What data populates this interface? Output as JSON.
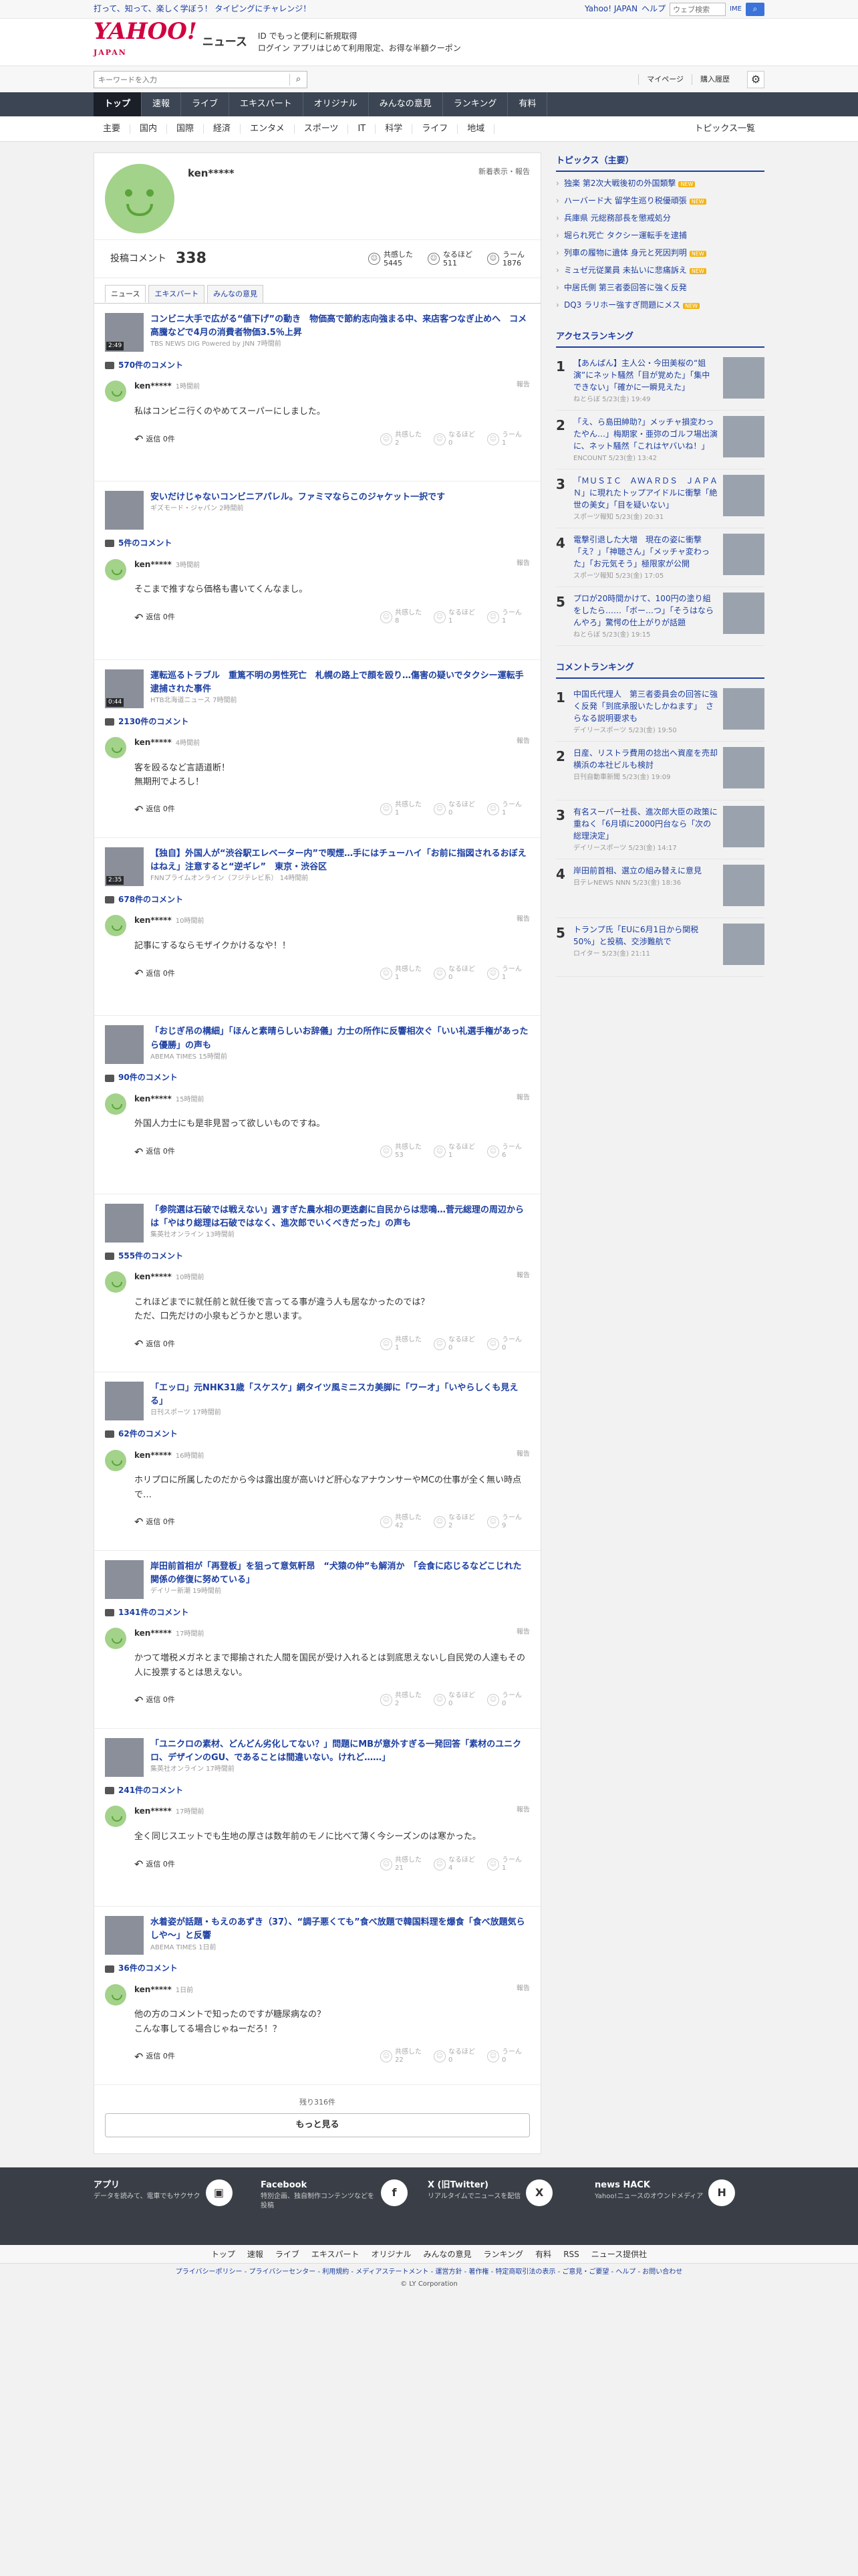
{
  "topbar": {
    "left_text": "打って、知って、楽しく学ぼう！ タイピングにチャレンジ！",
    "links": [
      "Yahoo! JAPAN",
      "ヘルプ"
    ],
    "search_placeholder": "ウェブ検索",
    "ime": "IME"
  },
  "header": {
    "logo": "YAHOO!",
    "logo_sub": "JAPAN",
    "service": "ニュース",
    "promo_line1": "ID でもっと便利に新規取得",
    "promo_line2": "ログイン  アプリはじめて利用限定、お得な半額クーポン"
  },
  "searchrow": {
    "placeholder": "キーワードを入力",
    "mypage": "マイページ",
    "history": "購入履歴"
  },
  "gnav": [
    "トップ",
    "速報",
    "ライブ",
    "エキスパート",
    "オリジナル",
    "みんなの意見",
    "ランキング",
    "有料"
  ],
  "subnav": [
    "主要",
    "国内",
    "国際",
    "経済",
    "エンタメ",
    "スポーツ",
    "IT",
    "科学",
    "ライフ",
    "地域"
  ],
  "subnav_all": "トピックス一覧",
  "profile": {
    "name": "ken*****",
    "badge": "新着表示・報告",
    "label": "投稿コメント",
    "count": "338",
    "reactions": [
      {
        "label": "共感した",
        "value": "5445"
      },
      {
        "label": "なるほど",
        "value": "511"
      },
      {
        "label": "うーん",
        "value": "1876"
      }
    ]
  },
  "tabs": [
    "ニュース",
    "エキスパート",
    "みんなの意見"
  ],
  "vote_labels": [
    "共感した",
    "なるほど",
    "うーん"
  ],
  "reply_label": "返信 0件",
  "report_label": "報告",
  "entries": [
    {
      "title": "コンビニ大手で広がる“値下げ”の動き　物価高で節約志向強まる中、来店客つなぎ止めへ　コメ高騰などで4月の消費者物価3.5％上昇",
      "source": "TBS NEWS DIG Powered by JNN 7時間前",
      "video": "2:49",
      "comments": "570件のコメント",
      "user": "ken*****",
      "time": "1時間前",
      "text": "私はコンビニ行くのやめてスーパーにしました。",
      "votes": [
        "2",
        "0",
        "1"
      ]
    },
    {
      "title": "安いだけじゃないコンビニアパレル。ファミマならこのジャケット一択です",
      "source": "ギズモード・ジャパン 2時間前",
      "video": "",
      "comments": "5件のコメント",
      "user": "ken*****",
      "time": "3時間前",
      "text": "そこまで推すなら価格も書いてくんなまし。",
      "votes": [
        "8",
        "1",
        "1"
      ]
    },
    {
      "title": "運転巡るトラブル　重篤不明の男性死亡　札幌の路上で顔を殴り…傷害の疑いでタクシー運転手逮捕された事件",
      "source": "HTB北海道ニュース 7時間前",
      "video": "0:44",
      "comments": "2130件のコメント",
      "user": "ken*****",
      "time": "4時間前",
      "text": "客を殴るなど言語道断！\n無期刑でよろし！",
      "votes": [
        "1",
        "0",
        "1"
      ]
    },
    {
      "title": "【独自】外国人が“渋谷駅エレベーター内”で喫煙…手にはチューハイ「お前に指図されるおぼえはねえ」注意すると“逆ギレ”　東京・渋谷区",
      "source": "FNNプライムオンライン（フジテレビ系） 14時間前",
      "video": "2:35",
      "comments": "678件のコメント",
      "user": "ken*****",
      "time": "10時間前",
      "text": "記事にするならモザイクかけるなや！！",
      "votes": [
        "1",
        "0",
        "1"
      ]
    },
    {
      "title": "「おじぎ吊の構細」「ほんと素晴らしいお辞儀」力士の所作に反響相次ぐ「いい礼選手権があったら優勝」の声も",
      "source": "ABEMA TIMES 15時間前",
      "video": "",
      "comments": "90件のコメント",
      "user": "ken*****",
      "time": "15時間前",
      "text": "外国人力士にも是非見習って欲しいものですね。",
      "votes": [
        "53",
        "1",
        "6"
      ]
    },
    {
      "title": "「参院選は石破では戦えない」週すぎた農水相の更迭劇に自民からは悲鳴…菅元総理の周辺からは「やはり総理は石破ではなく、進次郎でいくべきだった」の声も",
      "source": "集英社オンライン 13時間前",
      "video": "",
      "comments": "555件のコメント",
      "user": "ken*****",
      "time": "10時間前",
      "text": "これほどまでに就任前と就任後で言ってる事が違う人も居なかったのでは？\nただ、口先だけの小泉もどうかと思います。",
      "votes": [
        "1",
        "0",
        "0"
      ]
    },
    {
      "title": "「エッロ」元NHK31歳「スケスケ」網タイツ風ミニスカ美脚に「ワーオ」「いやらしくも見える」",
      "source": "日刊スポーツ 17時間前",
      "video": "",
      "comments": "62件のコメント",
      "user": "ken*****",
      "time": "16時間前",
      "text": "ホリプロに所属したのだから今は露出度が高いけど肝心なアナウンサーやMCの仕事が全く無い時点で…",
      "votes": [
        "42",
        "2",
        "9"
      ]
    },
    {
      "title": "岸田前首相が「再登板」を狙って意気軒昂　“犬猿の仲”も解消か　「会食に応じるなどこじれた関係の修復に努めている」",
      "source": "デイリー新潮 19時間前",
      "video": "",
      "comments": "1341件のコメント",
      "user": "ken*****",
      "time": "17時間前",
      "text": "かつて増税メガネとまで揶揄された人間を国民が受け入れるとは到底思えないし自民党の人達もその人に投票するとは思えない。",
      "votes": [
        "2",
        "0",
        "0"
      ]
    },
    {
      "title": "「ユニクロの素材、どんどん劣化してない？」問題にMBが意外すぎる一発回答「素材のユニクロ、デザインのGU、であることは間違いない。けれど……」",
      "source": "集英社オンライン 17時間前",
      "video": "",
      "comments": "241件のコメント",
      "user": "ken*****",
      "time": "17時間前",
      "text": "全く同じスエットでも生地の厚さは数年前のモノに比べて薄く今シーズンのは寒かった。",
      "votes": [
        "21",
        "4",
        "1"
      ]
    },
    {
      "title": "水着姿が話題・もえのあずき（37）、“調子悪くても”食べ放題で韓国料理を爆食「食べ放題気らしや～」と反響",
      "source": "ABEMA TIMES 1日前",
      "video": "",
      "comments": "36件のコメント",
      "user": "ken*****",
      "time": "1日前",
      "text": "他の方のコメントで知ったのですが糖尿病なの？\nこんな事してる場合じゃねーだろ！？",
      "votes": [
        "22",
        "0",
        "0"
      ]
    }
  ],
  "more": {
    "remaining": "残り316件",
    "button": "もっと見る"
  },
  "sidebar": {
    "topics_title": "トピックス（主要）",
    "topics": [
      "独楽 第2次大戦後初の外国類撃",
      "ハーバード大 留学生巡り税優頑張",
      "兵庫県 元総務部長を懲戒処分",
      "堀られ死亡 タクシー運転手を逮捕",
      "列車の履物に遺体 身元と死因判明",
      "ミュゼ元従業員 未払いに悲痛訴え",
      "中居氏側 第三者委回答に強く反発",
      "DQ3 ラリホー強すぎ問題にメス"
    ],
    "topic_flags": [
      "new",
      "new",
      "",
      "",
      "new",
      "new",
      "",
      "new"
    ],
    "access_title": "アクセスランキング",
    "access": [
      {
        "title": "【あんぱん】主人公・今田美桜の“姐演”にネット騒然「目が覚めた」「集中できない」「確かに一瞬見えた」",
        "source": "ねとらぼ 5/23(金) 19:49"
      },
      {
        "title": "「え、ら島田紳助?」メッチャ損変わったやん…」梅期家・亜弥のゴルフ場出演に、ネット騒然「これはヤバいね！」",
        "source": "ENCOUNT 5/23(金) 13:42"
      },
      {
        "title": "「ＭＵＳＩＣ　ＡＷＡＲＤＳ　ＪＡＰＡＮ」に現れたトップアイドルに衝撃「絶世の美女」「目を疑いない」",
        "source": "スポーツ報知 5/23(金) 20:31"
      },
      {
        "title": "電撃引退した大増　現在の姿に衝撃「え？」「神聴さん」「メッチャ変わった」「お元気そう」極限家が公開",
        "source": "スポーツ報知 5/23(金) 17:05"
      },
      {
        "title": "プロが20時間かけて、100円の塗り組をしたら……「ボー…つ」「そうはならんやろ」驚愕の仕上がりが話題",
        "source": "ねとらぼ 5/23(金) 19:15"
      }
    ],
    "comment_title": "コメントランキング",
    "comment_rank": [
      {
        "title": "中国氏代理人　第三者委員会の回答に強く反発「到底承服いたしかねます」　さらなる説明要求も",
        "source": "デイリースポーツ 5/23(金) 19:50"
      },
      {
        "title": "日産、リストラ費用の捻出へ資産を売却　横浜の本社ビルも検討",
        "source": "日刊自動車新聞 5/23(金) 19:09"
      },
      {
        "title": "有名スーパー社長、進次郎大臣の政策に重ねく「6月頃に2000円台なら「次の総理決定」",
        "source": "デイリースポーツ 5/23(金) 14:17"
      },
      {
        "title": "岸田前首相、選立の組み替えに意見",
        "source": "日テレNEWS NNN 5/23(金) 18:36"
      },
      {
        "title": "トランプ氏「EUに6月1日から関税50%」と投稿、交渉難航で",
        "source": "ロイター 5/23(金) 21:11"
      }
    ]
  },
  "footer": {
    "cards": [
      {
        "title": "アプリ",
        "desc": "データを読みて、電車でもサクサク",
        "icon": "app-icon",
        "glyph": "▣"
      },
      {
        "title": "Facebook",
        "desc": "特別企画、独自制作コンテンツなどを投稿",
        "icon": "facebook-icon",
        "glyph": "f"
      },
      {
        "title": "X (旧Twitter)",
        "desc": "リアルタイムでニュースを配信",
        "icon": "x-icon",
        "glyph": "X"
      },
      {
        "title": "news HACK",
        "desc": "Yahoo!ニュースのオウンドメディア",
        "icon": "newshack-icon",
        "glyph": "H"
      }
    ],
    "nav": [
      "トップ",
      "速報",
      "ライブ",
      "エキスパート",
      "オリジナル",
      "みんなの意見",
      "ランキング",
      "有料",
      "RSS",
      "ニュース提供社"
    ],
    "links": "プライバシーポリシー - プライバシーセンター - 利用規約 - メディアステートメント - 運営方針 - 著作権 - 特定商取引法の表示 - ご意見・ご要望 - ヘルプ - お問い合わせ",
    "copyright": "© LY Corporation"
  }
}
